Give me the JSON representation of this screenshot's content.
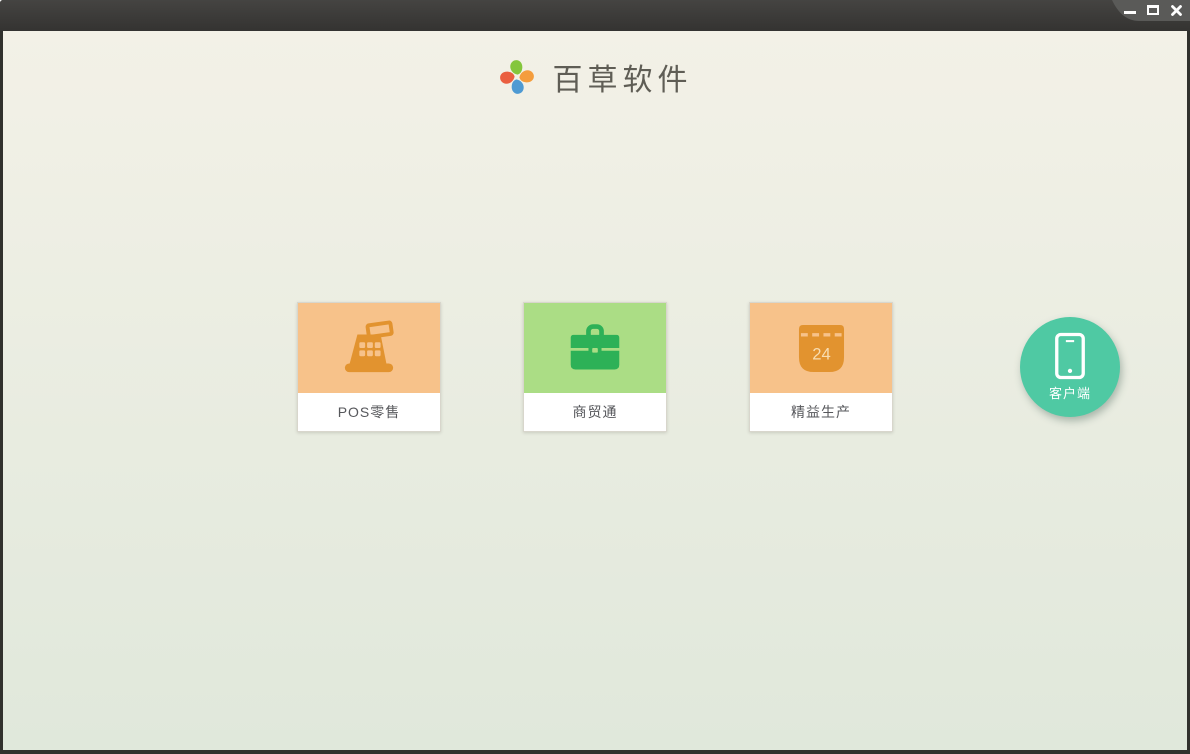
{
  "window": {
    "controls": {
      "minimize": "minimize",
      "maximize": "maximize",
      "close": "close"
    }
  },
  "header": {
    "app_name": "百草软件",
    "logo_petal_colors": {
      "top": "#84c63c",
      "right": "#f49d3d",
      "bottom": "#4e9ad3",
      "left": "#ea5f40"
    }
  },
  "products": [
    {
      "label": "POS零售",
      "icon": "cash-register-icon",
      "tile_color": "#f7c28a",
      "icon_color": "#e2932f"
    },
    {
      "label": "商贸通",
      "icon": "briefcase-icon",
      "tile_color": "#abdd85",
      "icon_color": "#2db157"
    },
    {
      "label": "精益生产",
      "icon": "calendar-icon",
      "calendar_day": "24",
      "tile_color": "#f7c28a",
      "icon_color": "#e2932f"
    }
  ],
  "client": {
    "label": "客户端",
    "icon": "smartphone-icon",
    "bg_color": "#4fc9a3"
  },
  "theme": {
    "titlebar_color": "#3a3937",
    "bg_top": "#f3f1e7",
    "bg_bottom": "#e0e8db",
    "card_label_color": "#56575b"
  }
}
